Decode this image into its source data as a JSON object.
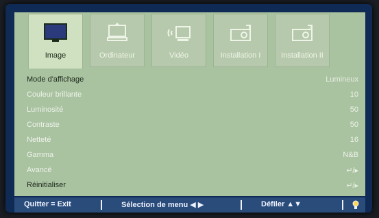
{
  "tabs": [
    {
      "label": "Image",
      "icon": "monitor-image-icon",
      "active": true
    },
    {
      "label": "Ordinateur",
      "icon": "computer-icon",
      "active": false
    },
    {
      "label": "Vidéo",
      "icon": "video-signal-icon",
      "active": false
    },
    {
      "label": "Installation I",
      "icon": "projector-installation-icon",
      "active": false
    },
    {
      "label": "Installation II",
      "icon": "projector-installation-2-icon",
      "active": false
    }
  ],
  "menu": [
    {
      "label": "Mode d'affichage",
      "value": "Lumineux",
      "enabled": true
    },
    {
      "label": "Couleur brillante",
      "value": "10",
      "enabled": false
    },
    {
      "label": "Luminosité",
      "value": "50",
      "enabled": false
    },
    {
      "label": "Contraste",
      "value": "50",
      "enabled": false
    },
    {
      "label": "Netteté",
      "value": "16",
      "enabled": false
    },
    {
      "label": "Gamma",
      "value": "N&B",
      "enabled": false
    },
    {
      "label": "Avancé",
      "value": "↵/▸",
      "enabled": false
    },
    {
      "label": "Réinitialiser",
      "value": "↵/▸",
      "enabled": true
    }
  ],
  "bottom_bar": {
    "quit": "Quitter = Exit",
    "select": "Sélection de menu ◀ ▶",
    "scroll": "Défiler ▲▼",
    "light_icon": "lightbulb-icon"
  },
  "colors": {
    "osd_bg": "#a9c2a0",
    "active_tab": "#cfe1c1",
    "bar": "#2a4c7a"
  }
}
